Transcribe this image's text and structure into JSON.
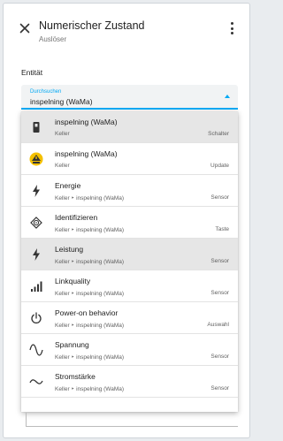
{
  "header": {
    "close_icon": "close-icon",
    "title": "Numerischer Zustand",
    "subtitle": "Auslöser",
    "more_icon": "more-vert-icon"
  },
  "section": {
    "label": "Entität"
  },
  "entity_field": {
    "label": "Durchsuchen",
    "value": "inspelning (WaMa)",
    "accent_color": "#03a9f4"
  },
  "dropdown": {
    "items": [
      {
        "icon": "switch-icon",
        "title": "inspelning (WaMa)",
        "path": "Keller",
        "domain": "Schalter",
        "highlighted": true
      },
      {
        "icon": "update-icon",
        "title": "inspelning (WaMa)",
        "path": "Keller",
        "domain": "Update",
        "highlighted": false
      },
      {
        "icon": "flash-icon",
        "title": "Energie",
        "path": "Keller ‣ inspelning (WaMa)",
        "domain": "Sensor",
        "highlighted": false
      },
      {
        "icon": "identify-icon",
        "title": "Identifizieren",
        "path": "Keller ‣ inspelning (WaMa)",
        "domain": "Taste",
        "highlighted": false
      },
      {
        "icon": "flash-icon",
        "title": "Leistung",
        "path": "Keller ‣ inspelning (WaMa)",
        "domain": "Sensor",
        "highlighted": true
      },
      {
        "icon": "signal-icon",
        "title": "Linkquality",
        "path": "Keller ‣ inspelning (WaMa)",
        "domain": "Sensor",
        "highlighted": false
      },
      {
        "icon": "power-icon",
        "title": "Power-on behavior",
        "path": "Keller ‣ inspelning (WaMa)",
        "domain": "Auswahl",
        "highlighted": false
      },
      {
        "icon": "sine-wave-icon",
        "title": "Spannung",
        "path": "Keller ‣ inspelning (WaMa)",
        "domain": "Sensor",
        "highlighted": false
      },
      {
        "icon": "current-icon",
        "title": "Stromstärke",
        "path": "Keller ‣ inspelning (WaMa)",
        "domain": "Sensor",
        "highlighted": false
      }
    ]
  }
}
